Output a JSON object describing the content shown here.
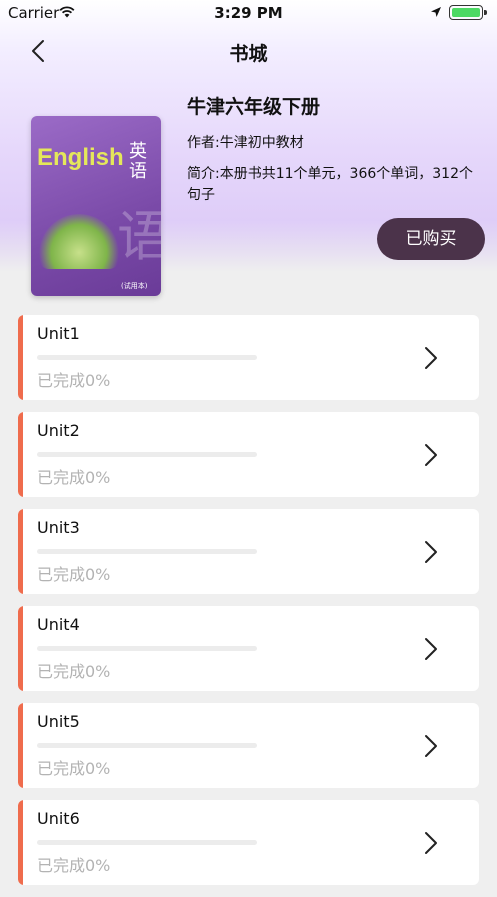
{
  "status_bar": {
    "carrier": "Carrier",
    "time": "3:29 PM"
  },
  "nav": {
    "title": "书城"
  },
  "book": {
    "title": "牛津六年级下册",
    "author": "作者:牛津初中教材",
    "intro": "简介:本册书共11个单元，366个单词，312个句子",
    "cover": {
      "english": "English",
      "chinese": "英语",
      "watermark": "语",
      "edition": "(试用本)"
    }
  },
  "purchase_button": "已购买",
  "units": [
    {
      "name": "Unit1",
      "status": "已完成0%",
      "progress": 0
    },
    {
      "name": "Unit2",
      "status": "已完成0%",
      "progress": 0
    },
    {
      "name": "Unit3",
      "status": "已完成0%",
      "progress": 0
    },
    {
      "name": "Unit4",
      "status": "已完成0%",
      "progress": 0
    },
    {
      "name": "Unit5",
      "status": "已完成0%",
      "progress": 0
    },
    {
      "name": "Unit6",
      "status": "已完成0%",
      "progress": 0
    }
  ],
  "colors": {
    "accent": "#ef6c4d",
    "button": "#4b334a",
    "battery": "#4cd964"
  },
  "icons": [
    "wifi-icon",
    "location-icon",
    "battery-icon",
    "back-chevron-icon",
    "chevron-right-icon"
  ]
}
